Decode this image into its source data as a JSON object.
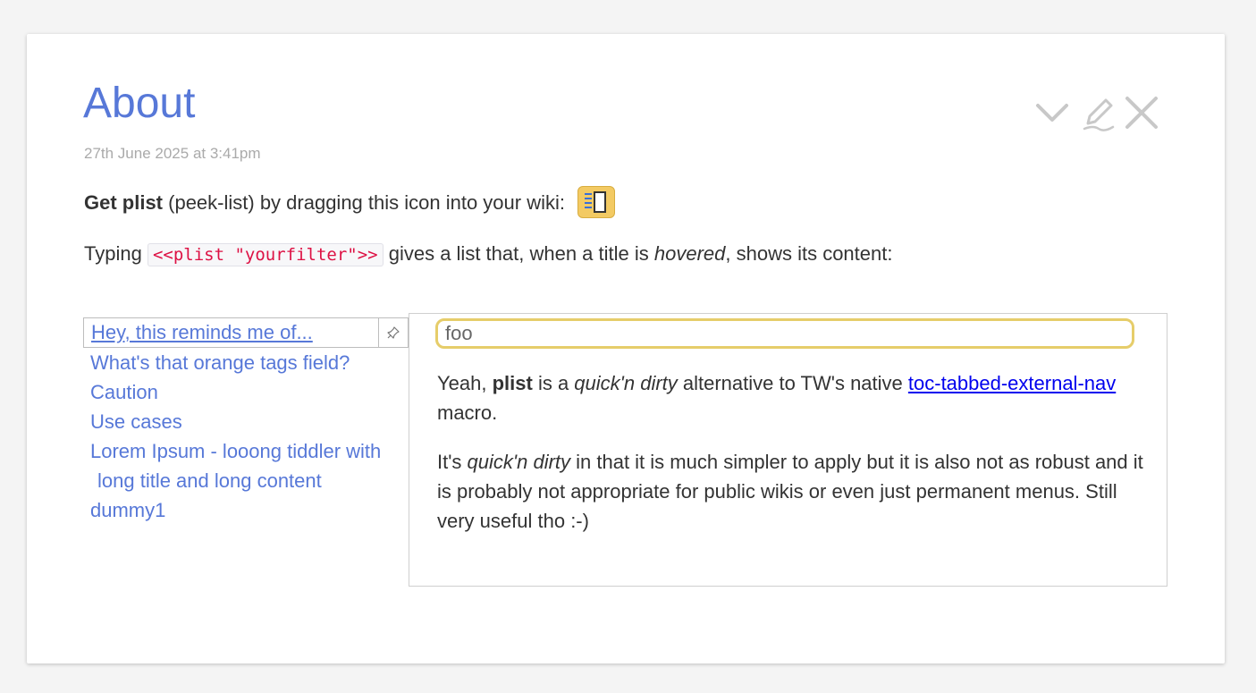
{
  "tiddler": {
    "title": "About",
    "modified": "27th June 2025 at 3:41pm",
    "controls": {
      "fold_icon": "chevron-down-icon",
      "edit_icon": "pencil-icon",
      "close_icon": "close-icon"
    }
  },
  "body": {
    "get_plist": {
      "bold": "Get plist",
      "text": " (peek-list) by dragging this icon into your wiki:",
      "bookmarklet_icon": "plist-sidebar-icon"
    },
    "typing": {
      "prefix": "Typing ",
      "code": "<<plist \"yourfilter\">>",
      "middle": " gives a list that, when a title is ",
      "emphasis": "hovered",
      "suffix": ", shows its content:"
    }
  },
  "plist": {
    "items": [
      {
        "label": "Hey, this reminds me of..."
      },
      {
        "label": "What's that orange tags field?"
      },
      {
        "label": "Caution"
      },
      {
        "label": "Use cases"
      },
      {
        "label": "Lorem Ipsum - looong tiddler with",
        "label_cont": "long title and long content"
      },
      {
        "label": "dummy1"
      }
    ],
    "pin_icon": "pin-icon"
  },
  "preview": {
    "search_value": "foo",
    "para1": {
      "t1": "Yeah, ",
      "b1": "plist",
      "t2": " is a ",
      "i1": "quick'n dirty",
      "t3": " alternative to TW's native ",
      "link": "toc-tabbed-external-nav",
      "t4": " macro."
    },
    "para2": {
      "t1": "It's ",
      "i1": "quick'n dirty",
      "t2": " in that it is much simpler to apply but it is also not as robust and it is probably not appropriate for public wikis or even just permanent menus. Still very useful tho :-)"
    }
  },
  "colors": {
    "title": "#5778d8",
    "link": "#5778d8",
    "bookmarklet_bg": "#f3ca63",
    "search_border": "#e6cd6a",
    "code_text": "#dd1144",
    "external_link": "#0000ee"
  }
}
